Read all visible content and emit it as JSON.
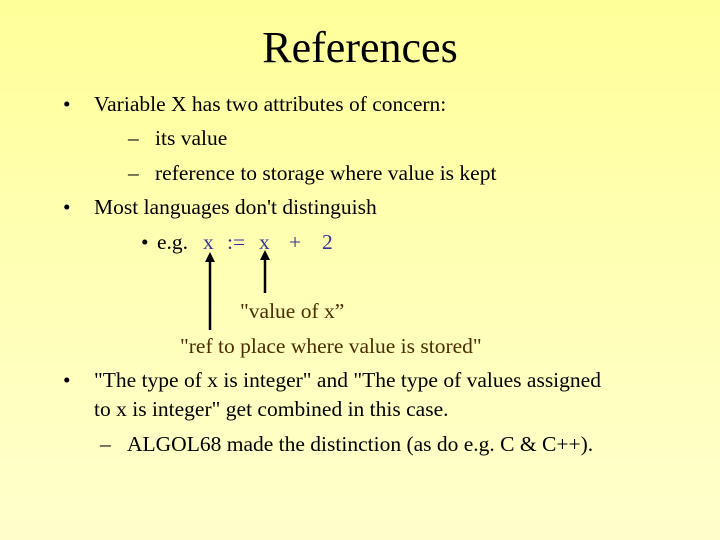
{
  "slide": {
    "title": "References",
    "bullet_glyph": "•",
    "dash_glyph": "–",
    "items": [
      {
        "text": "Variable X has two attributes of concern:"
      },
      {
        "text": "its value"
      },
      {
        "text": "reference to storage where value is kept"
      },
      {
        "text": "Most languages don't distinguish"
      },
      {
        "text": "e.g."
      },
      {
        "text": "\"The type of x is integer\" and \"The type of values assigned"
      },
      {
        "text": "to x is integer\" get combined in this case."
      },
      {
        "text": "ALGOL68 made the distinction (as do e.g. C & C++)."
      }
    ],
    "code_example": {
      "lhs": "x",
      "op": ":=",
      "rhs": "x",
      "plus": "+",
      "constant": "2"
    },
    "annotations": {
      "value_of_x": "\"value of x”",
      "ref_to_place": "\"ref to place where value is stored\""
    },
    "colors": {
      "background_top": "#ffff99",
      "background_bottom": "#ffffcc",
      "code": "#333399",
      "annotation": "#4a2c00"
    }
  }
}
